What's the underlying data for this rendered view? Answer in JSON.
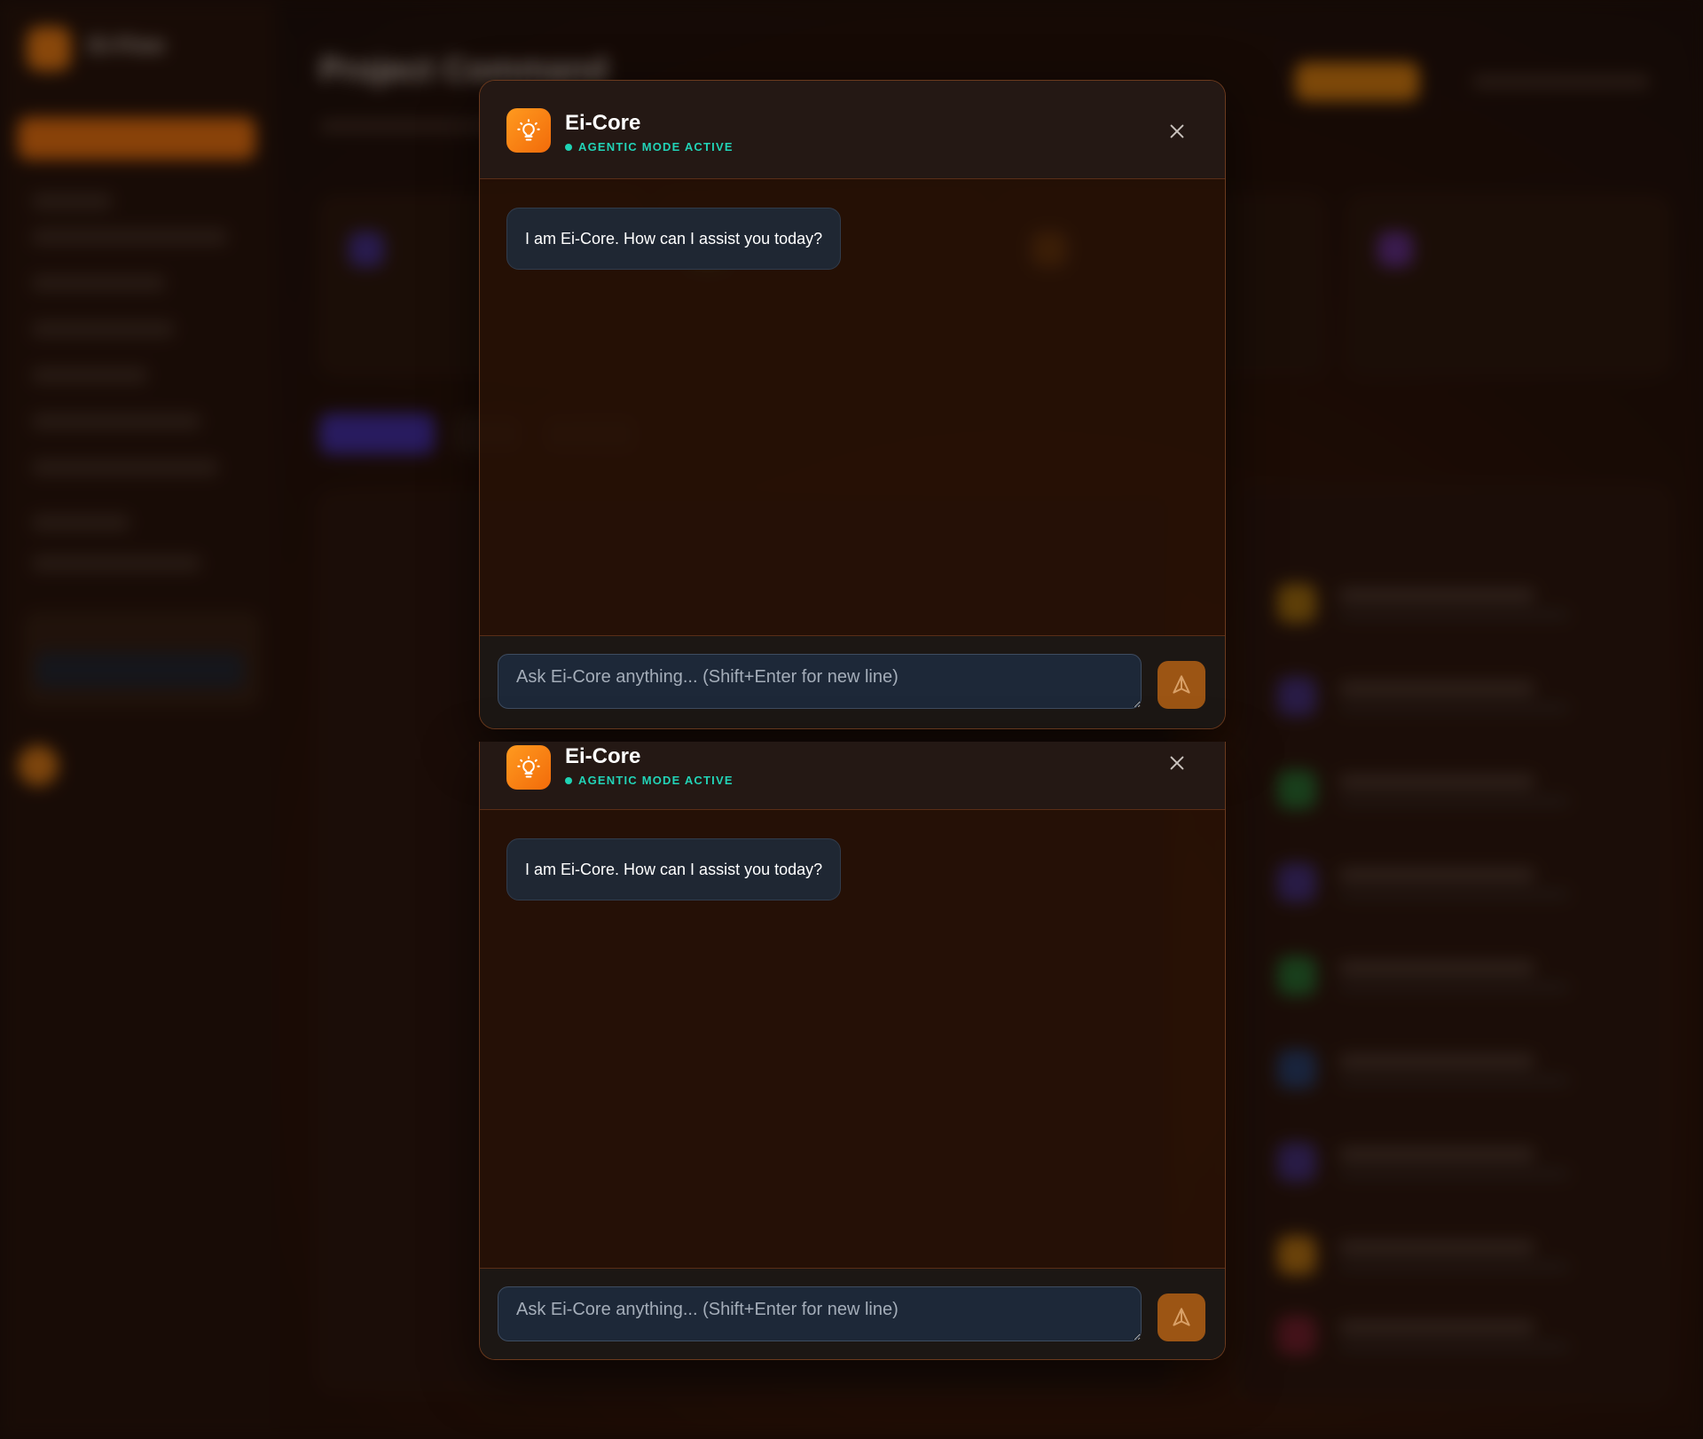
{
  "background": {
    "brand": "Ei-Flow",
    "page_title": "Project Command"
  },
  "chat_panels": [
    {
      "assistant_name": "Ei-Core",
      "status": "AGENTIC MODE ACTIVE",
      "greeting": "I am Ei-Core. How can I assist you today?",
      "input_placeholder": "Ask Ei-Core anything... (Shift+Enter for new line)"
    },
    {
      "assistant_name": "Ei-Core",
      "status": "AGENTIC MODE ACTIVE",
      "greeting": "I am Ei-Core. How can I assist you today?",
      "input_placeholder": "Ask Ei-Core anything... (Shift+Enter for new line)"
    }
  ],
  "icons": {
    "avatar": "lightbulb-icon",
    "close": "close-icon",
    "send": "send-icon"
  },
  "colors": {
    "accent": "#f2780c",
    "status": "#22d3b7"
  }
}
